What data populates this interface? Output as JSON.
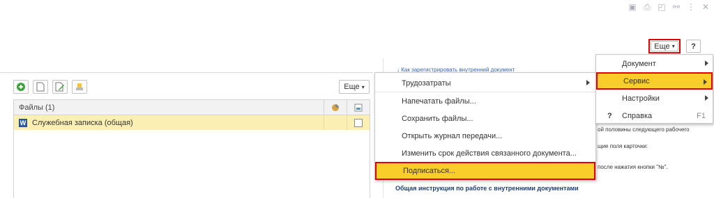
{
  "top_more_label": "Еще",
  "help_label": "?",
  "link_top": "↓ Как зарегистрировать внутренний документ",
  "left_panel": {
    "more_label": "Еще",
    "grid_header": "Файлы (1)",
    "row_label": "Служебная записка (общая)",
    "row_icon_letter": "W"
  },
  "dropdown": [
    {
      "label": "Трудозатраты",
      "has_arrow": true
    },
    {
      "label": "Напечатать файлы..."
    },
    {
      "label": "Сохранить файлы..."
    },
    {
      "label": "Открыть журнал передачи..."
    },
    {
      "label": "Изменить срок действия связанного документа..."
    },
    {
      "label": "Подписаться..."
    }
  ],
  "submenu": [
    {
      "label": "Документ"
    },
    {
      "label": "Сервис"
    },
    {
      "label": "Настройки"
    },
    {
      "label": "Справка",
      "shortcut": "F1",
      "prefix": "?"
    }
  ],
  "bg_texts": [
    "ой половины следующего рабочего",
    "щие поля карточки:",
    "после нажатия кнопки \"№\"."
  ],
  "bg_bold": "Общая инструкция по работе с внутренними документами"
}
